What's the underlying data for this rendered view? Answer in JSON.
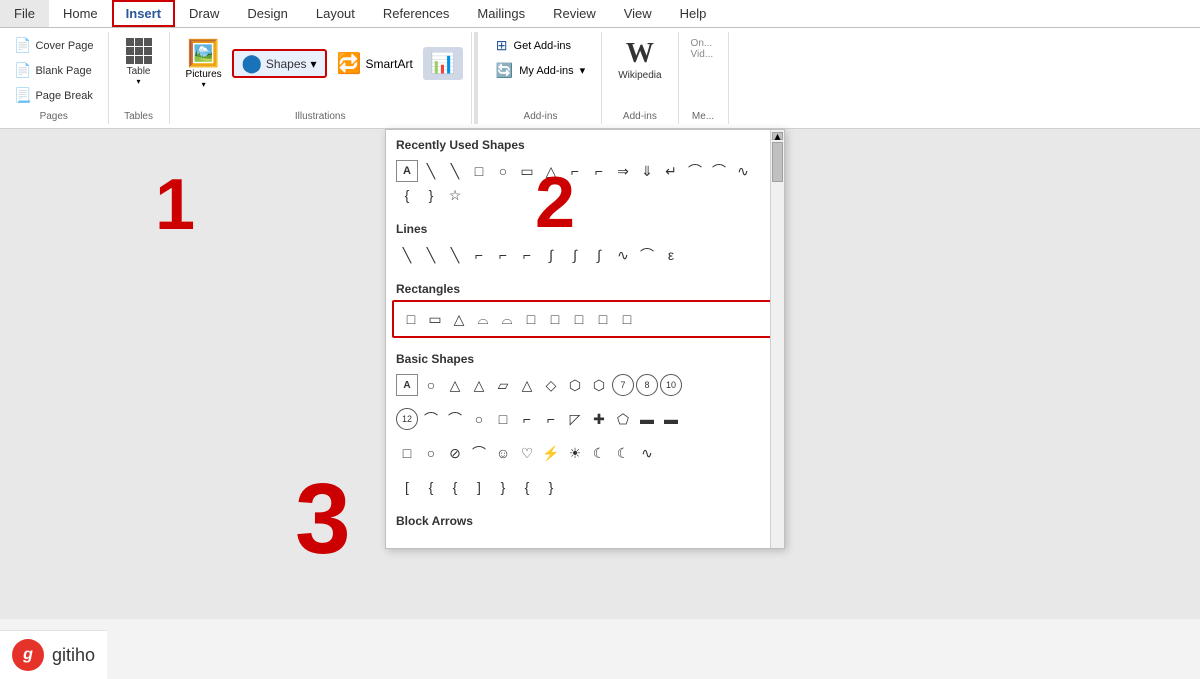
{
  "tabs": {
    "items": [
      "File",
      "Home",
      "Insert",
      "Draw",
      "Design",
      "Layout",
      "References",
      "Mailings",
      "Review",
      "View",
      "Help"
    ],
    "active": "Insert"
  },
  "ribbon": {
    "pages_group_label": "Pages",
    "tables_group_label": "Tables",
    "illustrations_group_label": "Illustrations",
    "addins_group_label": "Add-ins",
    "media_group_label": "Me...",
    "cover_page": "Cover Page",
    "blank_page": "Blank Page",
    "page_break": "Page Break",
    "table_label": "Table",
    "pictures_label": "Pictures",
    "shapes_label": "Shapes",
    "shapes_arrow": "▾",
    "smartart_label": "SmartArt",
    "get_addins": "Get Add-ins",
    "my_addins": "My Add-ins",
    "my_addins_arrow": "▾",
    "wikipedia": "Wikipedia",
    "online_video": "On... Vid..."
  },
  "dropdown": {
    "recently_used_title": "Recently Used Shapes",
    "lines_title": "Lines",
    "rectangles_title": "Rectangles",
    "basic_shapes_title": "Basic Shapes",
    "block_arrows_title": "Block Arrows",
    "recently_used_shapes": [
      "A",
      "\\",
      "\\",
      "□",
      "○",
      "□",
      "△",
      "⌐",
      "⌐",
      "⇒",
      "⇓",
      "↵",
      "⌒",
      "⌒",
      "∿",
      "{",
      "}",
      "☆"
    ],
    "lines_shapes": [
      "\\",
      "\\",
      "\\",
      "⌐",
      "⌐",
      "⌐",
      "∫",
      "∫",
      "∫",
      "∿",
      "⌒",
      "ε"
    ],
    "rectangle_shapes": [
      "□",
      "□",
      "△",
      "⌓",
      "⌓",
      "□",
      "□",
      "□",
      "□",
      "□"
    ],
    "basic_shapes_row1": [
      "A",
      "○",
      "△",
      "△",
      "▱",
      "△",
      "◇",
      "⬡",
      "⊙",
      "⑦",
      "⑧",
      "⑩"
    ],
    "basic_shapes_row2": [
      "⑫",
      "⌒",
      "⌒",
      "○",
      "□",
      "⌐",
      "⌐",
      "◸",
      "✚",
      "⬠",
      "▬",
      "▬"
    ],
    "basic_shapes_row3": [
      "□",
      "○",
      "⊘",
      "⌒",
      "☺",
      "♡",
      "⚡",
      "☀",
      "☾",
      "☾",
      "∿"
    ],
    "basic_shapes_row4": [
      "[",
      "{",
      "{",
      "[",
      "}",
      "{",
      "}"
    ]
  },
  "numbers": {
    "n1": "1",
    "n2": "2",
    "n3": "3"
  },
  "logo": {
    "icon": "g",
    "name": "gitiho"
  }
}
